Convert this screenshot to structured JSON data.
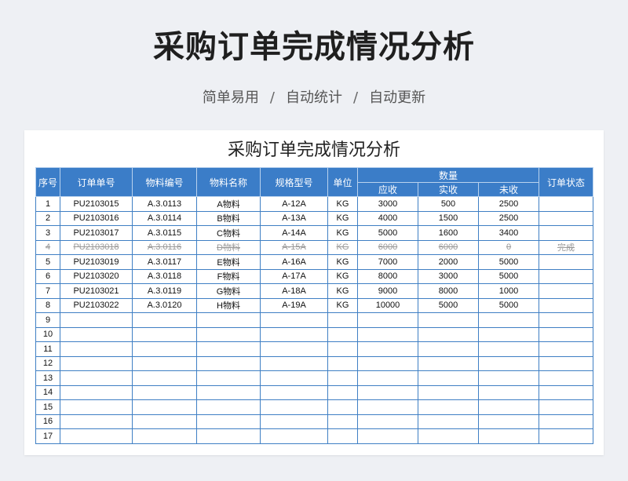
{
  "page": {
    "title": "采购订单完成情况分析",
    "subtitle": [
      "简单易用",
      "自动统计",
      "自动更新"
    ],
    "separator": "/"
  },
  "sheet": {
    "title": "采购订单完成情况分析",
    "headers": {
      "seq": "序号",
      "order_no": "订单单号",
      "material_code": "物料编号",
      "material_name": "物料名称",
      "spec": "规格型号",
      "unit": "单位",
      "quantity": "数量",
      "due": "应收",
      "received": "实收",
      "pending": "未收",
      "status": "订单状态"
    },
    "rows": [
      {
        "seq": "1",
        "order_no": "PU2103015",
        "material_code": "A.3.0113",
        "material_name": "A物料",
        "spec": "A-12A",
        "unit": "KG",
        "due": "3000",
        "received": "500",
        "pending": "2500",
        "status": "",
        "struck": false
      },
      {
        "seq": "2",
        "order_no": "PU2103016",
        "material_code": "A.3.0114",
        "material_name": "B物料",
        "spec": "A-13A",
        "unit": "KG",
        "due": "4000",
        "received": "1500",
        "pending": "2500",
        "status": "",
        "struck": false
      },
      {
        "seq": "3",
        "order_no": "PU2103017",
        "material_code": "A.3.0115",
        "material_name": "C物料",
        "spec": "A-14A",
        "unit": "KG",
        "due": "5000",
        "received": "1600",
        "pending": "3400",
        "status": "",
        "struck": false
      },
      {
        "seq": "4",
        "order_no": "PU2103018",
        "material_code": "A.3.0116",
        "material_name": "D物料",
        "spec": "A-15A",
        "unit": "KG",
        "due": "6000",
        "received": "6000",
        "pending": "0",
        "status": "完成",
        "struck": true
      },
      {
        "seq": "5",
        "order_no": "PU2103019",
        "material_code": "A.3.0117",
        "material_name": "E物料",
        "spec": "A-16A",
        "unit": "KG",
        "due": "7000",
        "received": "2000",
        "pending": "5000",
        "status": "",
        "struck": false
      },
      {
        "seq": "6",
        "order_no": "PU2103020",
        "material_code": "A.3.0118",
        "material_name": "F物料",
        "spec": "A-17A",
        "unit": "KG",
        "due": "8000",
        "received": "3000",
        "pending": "5000",
        "status": "",
        "struck": false
      },
      {
        "seq": "7",
        "order_no": "PU2103021",
        "material_code": "A.3.0119",
        "material_name": "G物料",
        "spec": "A-18A",
        "unit": "KG",
        "due": "9000",
        "received": "8000",
        "pending": "1000",
        "status": "",
        "struck": false
      },
      {
        "seq": "8",
        "order_no": "PU2103022",
        "material_code": "A.3.0120",
        "material_name": "H物料",
        "spec": "A-19A",
        "unit": "KG",
        "due": "10000",
        "received": "5000",
        "pending": "5000",
        "status": "",
        "struck": false
      },
      {
        "seq": "9",
        "order_no": "",
        "material_code": "",
        "material_name": "",
        "spec": "",
        "unit": "",
        "due": "",
        "received": "",
        "pending": "",
        "status": "",
        "struck": false
      },
      {
        "seq": "10",
        "order_no": "",
        "material_code": "",
        "material_name": "",
        "spec": "",
        "unit": "",
        "due": "",
        "received": "",
        "pending": "",
        "status": "",
        "struck": false
      },
      {
        "seq": "11",
        "order_no": "",
        "material_code": "",
        "material_name": "",
        "spec": "",
        "unit": "",
        "due": "",
        "received": "",
        "pending": "",
        "status": "",
        "struck": false
      },
      {
        "seq": "12",
        "order_no": "",
        "material_code": "",
        "material_name": "",
        "spec": "",
        "unit": "",
        "due": "",
        "received": "",
        "pending": "",
        "status": "",
        "struck": false
      },
      {
        "seq": "13",
        "order_no": "",
        "material_code": "",
        "material_name": "",
        "spec": "",
        "unit": "",
        "due": "",
        "received": "",
        "pending": "",
        "status": "",
        "struck": false
      },
      {
        "seq": "14",
        "order_no": "",
        "material_code": "",
        "material_name": "",
        "spec": "",
        "unit": "",
        "due": "",
        "received": "",
        "pending": "",
        "status": "",
        "struck": false
      },
      {
        "seq": "15",
        "order_no": "",
        "material_code": "",
        "material_name": "",
        "spec": "",
        "unit": "",
        "due": "",
        "received": "",
        "pending": "",
        "status": "",
        "struck": false
      },
      {
        "seq": "16",
        "order_no": "",
        "material_code": "",
        "material_name": "",
        "spec": "",
        "unit": "",
        "due": "",
        "received": "",
        "pending": "",
        "status": "",
        "struck": false
      },
      {
        "seq": "17",
        "order_no": "",
        "material_code": "",
        "material_name": "",
        "spec": "",
        "unit": "",
        "due": "",
        "received": "",
        "pending": "",
        "status": "",
        "struck": false
      }
    ]
  },
  "colors": {
    "header_bg": "#3b7dc8",
    "grid_line": "#3f7fc4",
    "page_bg": "#eef0f4",
    "struck_text": "#9a9a9a"
  }
}
